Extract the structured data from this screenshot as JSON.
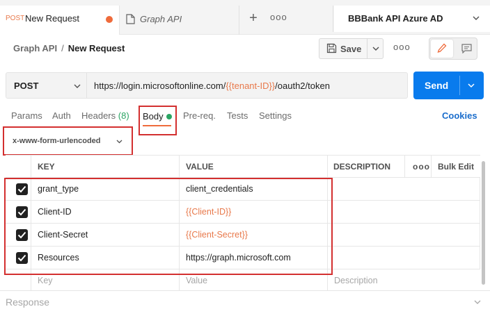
{
  "tabs": {
    "active": {
      "method": "POST",
      "title": "New Request"
    },
    "second": {
      "title": "Graph API"
    },
    "new_tab_symbol": "+",
    "more_symbol": "ooo"
  },
  "environment": {
    "selected": "BBBank API Azure AD"
  },
  "breadcrumb": {
    "parent": "Graph API",
    "separator": "/",
    "current": "New Request"
  },
  "toolbar": {
    "save_label": "Save",
    "more_symbol": "ooo"
  },
  "request": {
    "method": "POST",
    "url": {
      "prefix": "https://login.microsoftonline.com/",
      "variable": "{{tenant-ID}}",
      "suffix": "/oauth2/token"
    },
    "send_label": "Send"
  },
  "request_tabs": {
    "params": "Params",
    "auth": "Auth",
    "headers": "Headers",
    "headers_count": "(8)",
    "body": "Body",
    "prereq": "Pre-req.",
    "tests": "Tests",
    "settings": "Settings",
    "cookies": "Cookies"
  },
  "body_type": "x-www-form-urlencoded",
  "table": {
    "headers": {
      "key": "KEY",
      "value": "VALUE",
      "description": "DESCRIPTION",
      "more": "ooo",
      "bulk_edit": "Bulk Edit"
    },
    "rows": [
      {
        "key": "grant_type",
        "value": "client_credentials",
        "checked": true
      },
      {
        "key": "Client-ID",
        "value": "{{Client-ID}}",
        "checked": true
      },
      {
        "key": "Client-Secret",
        "value": "{{Client-Secret}}",
        "checked": true
      },
      {
        "key": "Resources",
        "value": "https://graph.microsoft.com",
        "checked": true
      }
    ],
    "placeholders": {
      "key": "Key",
      "value": "Value",
      "description": "Description"
    }
  },
  "response": {
    "label": "Response"
  },
  "colors": {
    "accent_orange": "#ef6b3b",
    "send_blue": "#097bed",
    "variable_orange": "#e8794b",
    "status_green": "#2aa563",
    "highlight_red": "#d32f2f"
  }
}
